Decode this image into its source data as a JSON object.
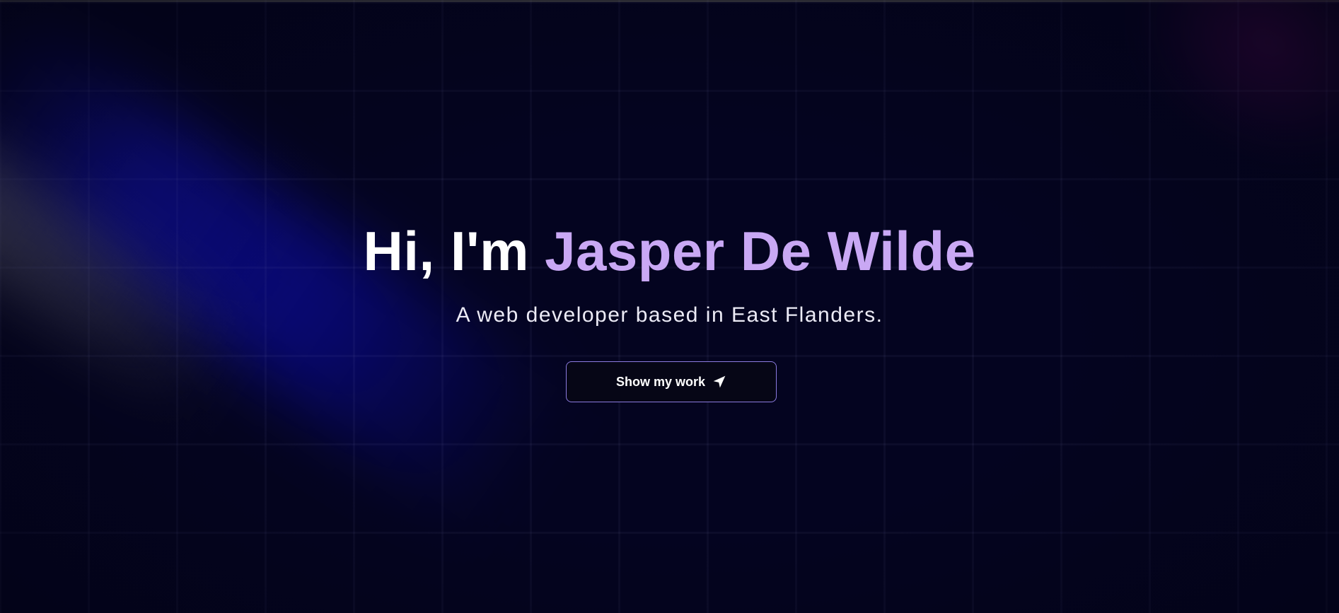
{
  "hero": {
    "greeting": "Hi, I'm",
    "name": "Jasper De Wilde",
    "subtitle": "A web developer based in East Flanders.",
    "cta_label": "Show my work",
    "cta_icon": "send-icon"
  },
  "colors": {
    "background": "#040420",
    "accent": "#c9a8f4",
    "button_border": "#8b7be0",
    "text": "#ffffff"
  }
}
